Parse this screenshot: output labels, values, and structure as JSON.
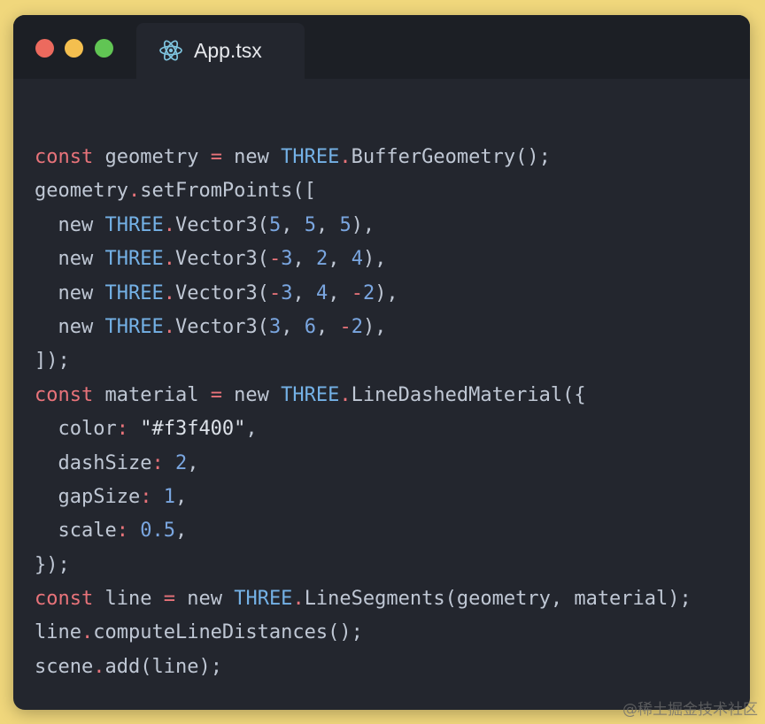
{
  "window": {
    "tab": {
      "label": "App.tsx",
      "icon": "react-icon"
    },
    "traffic_lights": {
      "close_color": "#ec6a5e",
      "minimize_color": "#f4bf4f",
      "maximize_color": "#61c554"
    }
  },
  "code": {
    "lines": [
      [
        {
          "t": "kw",
          "v": "const"
        },
        {
          "t": "id",
          "v": " geometry "
        },
        {
          "t": "op",
          "v": "="
        },
        {
          "t": "id",
          "v": " new "
        },
        {
          "t": "cls",
          "v": "THREE"
        },
        {
          "t": "op",
          "v": "."
        },
        {
          "t": "id",
          "v": "BufferGeometry();"
        }
      ],
      [
        {
          "t": "id",
          "v": "geometry"
        },
        {
          "t": "op",
          "v": "."
        },
        {
          "t": "id",
          "v": "setFromPoints(["
        }
      ],
      [
        {
          "t": "id",
          "v": "  new "
        },
        {
          "t": "cls",
          "v": "THREE"
        },
        {
          "t": "op",
          "v": "."
        },
        {
          "t": "id",
          "v": "Vector3("
        },
        {
          "t": "num",
          "v": "5"
        },
        {
          "t": "id",
          "v": ", "
        },
        {
          "t": "num",
          "v": "5"
        },
        {
          "t": "id",
          "v": ", "
        },
        {
          "t": "num",
          "v": "5"
        },
        {
          "t": "id",
          "v": "),"
        }
      ],
      [
        {
          "t": "id",
          "v": "  new "
        },
        {
          "t": "cls",
          "v": "THREE"
        },
        {
          "t": "op",
          "v": "."
        },
        {
          "t": "id",
          "v": "Vector3("
        },
        {
          "t": "neg",
          "v": "-"
        },
        {
          "t": "num",
          "v": "3"
        },
        {
          "t": "id",
          "v": ", "
        },
        {
          "t": "num",
          "v": "2"
        },
        {
          "t": "id",
          "v": ", "
        },
        {
          "t": "num",
          "v": "4"
        },
        {
          "t": "id",
          "v": "),"
        }
      ],
      [
        {
          "t": "id",
          "v": "  new "
        },
        {
          "t": "cls",
          "v": "THREE"
        },
        {
          "t": "op",
          "v": "."
        },
        {
          "t": "id",
          "v": "Vector3("
        },
        {
          "t": "neg",
          "v": "-"
        },
        {
          "t": "num",
          "v": "3"
        },
        {
          "t": "id",
          "v": ", "
        },
        {
          "t": "num",
          "v": "4"
        },
        {
          "t": "id",
          "v": ", "
        },
        {
          "t": "neg",
          "v": "-"
        },
        {
          "t": "num",
          "v": "2"
        },
        {
          "t": "id",
          "v": "),"
        }
      ],
      [
        {
          "t": "id",
          "v": "  new "
        },
        {
          "t": "cls",
          "v": "THREE"
        },
        {
          "t": "op",
          "v": "."
        },
        {
          "t": "id",
          "v": "Vector3("
        },
        {
          "t": "num",
          "v": "3"
        },
        {
          "t": "id",
          "v": ", "
        },
        {
          "t": "num",
          "v": "6"
        },
        {
          "t": "id",
          "v": ", "
        },
        {
          "t": "neg",
          "v": "-"
        },
        {
          "t": "num",
          "v": "2"
        },
        {
          "t": "id",
          "v": "),"
        }
      ],
      [
        {
          "t": "id",
          "v": "]);"
        }
      ],
      [
        {
          "t": "kw",
          "v": "const"
        },
        {
          "t": "id",
          "v": " material "
        },
        {
          "t": "op",
          "v": "="
        },
        {
          "t": "id",
          "v": " new "
        },
        {
          "t": "cls",
          "v": "THREE"
        },
        {
          "t": "op",
          "v": "."
        },
        {
          "t": "id",
          "v": "LineDashedMaterial({"
        }
      ],
      [
        {
          "t": "id",
          "v": "  color"
        },
        {
          "t": "op",
          "v": ":"
        },
        {
          "t": "str",
          "v": " \"#f3f400\""
        },
        {
          "t": "id",
          "v": ","
        }
      ],
      [
        {
          "t": "id",
          "v": "  dashSize"
        },
        {
          "t": "op",
          "v": ":"
        },
        {
          "t": "num",
          "v": " 2"
        },
        {
          "t": "id",
          "v": ","
        }
      ],
      [
        {
          "t": "id",
          "v": "  gapSize"
        },
        {
          "t": "op",
          "v": ":"
        },
        {
          "t": "num",
          "v": " 1"
        },
        {
          "t": "id",
          "v": ","
        }
      ],
      [
        {
          "t": "id",
          "v": "  scale"
        },
        {
          "t": "op",
          "v": ":"
        },
        {
          "t": "num",
          "v": " 0.5"
        },
        {
          "t": "id",
          "v": ","
        }
      ],
      [
        {
          "t": "id",
          "v": "});"
        }
      ],
      [
        {
          "t": "kw",
          "v": "const"
        },
        {
          "t": "id",
          "v": " line "
        },
        {
          "t": "op",
          "v": "="
        },
        {
          "t": "id",
          "v": " new "
        },
        {
          "t": "cls",
          "v": "THREE"
        },
        {
          "t": "op",
          "v": "."
        },
        {
          "t": "id",
          "v": "LineSegments(geometry, material);"
        }
      ],
      [
        {
          "t": "id",
          "v": "line"
        },
        {
          "t": "op",
          "v": "."
        },
        {
          "t": "id",
          "v": "computeLineDistances();"
        }
      ],
      [
        {
          "t": "id",
          "v": "scene"
        },
        {
          "t": "op",
          "v": "."
        },
        {
          "t": "id",
          "v": "add(line);"
        }
      ]
    ]
  },
  "watermark": "@稀土掘金技术社区",
  "colors": {
    "page_background": "#f0d77c",
    "editor_background": "#23262e",
    "titlebar_background": "#1c1f25",
    "keyword": "#e8737a",
    "class_name": "#74b1e6",
    "number": "#7aa6e0",
    "identifier": "#bfc7d4"
  }
}
